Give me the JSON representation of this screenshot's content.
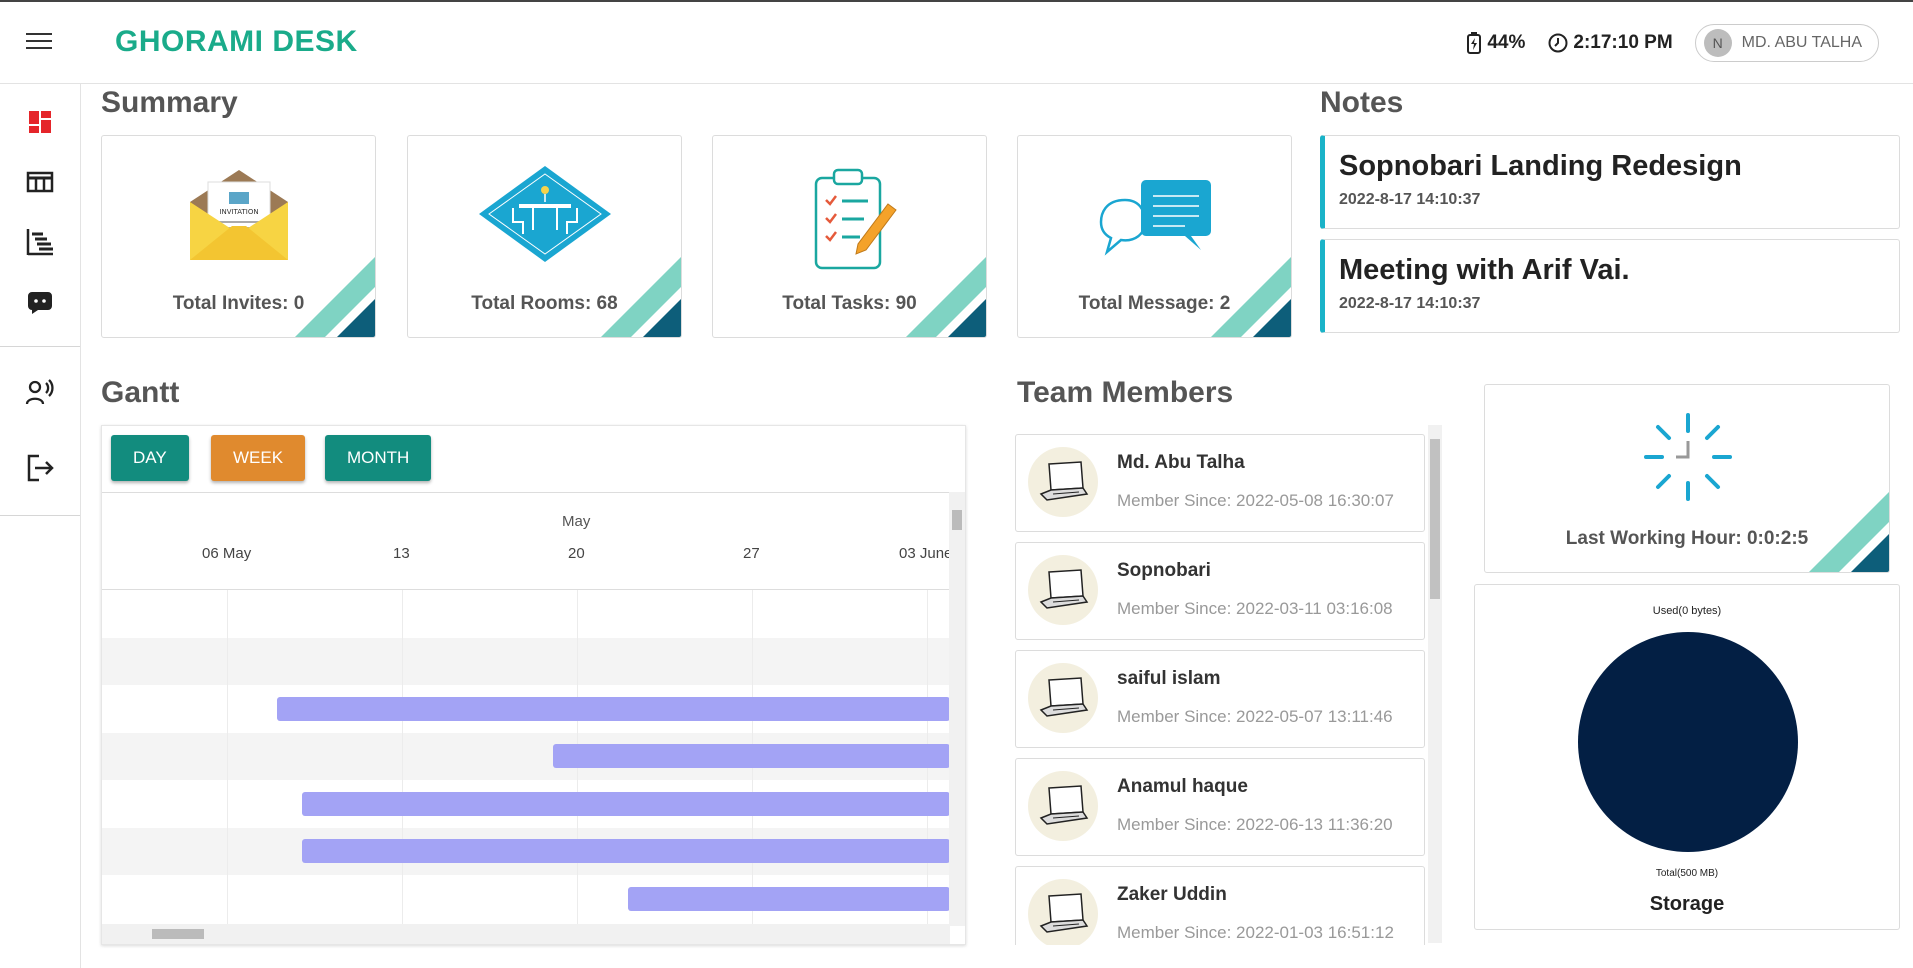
{
  "header": {
    "brand": "GHORAMI DESK",
    "battery": "44%",
    "clock": "2:17:10 PM",
    "user_initial": "N",
    "user_name": "MD. ABU TALHA"
  },
  "summary": {
    "title": "Summary",
    "cards": [
      {
        "caption": "Total Invites: 0",
        "icon": "invitation-envelope-icon"
      },
      {
        "caption": "Total Rooms: 68",
        "icon": "meeting-room-icon"
      },
      {
        "caption": "Total Tasks: 90",
        "icon": "clipboard-tasks-icon"
      },
      {
        "caption": "Total Message: 2",
        "icon": "chat-bubbles-icon"
      }
    ],
    "envelope_card_text": "INVITATION"
  },
  "notes": {
    "title": "Notes",
    "items": [
      {
        "title": "Sopnobari Landing Redesign",
        "date": "2022-8-17 14:10:37"
      },
      {
        "title": "Meeting with Arif Vai.",
        "date": "2022-8-17 14:10:37"
      }
    ]
  },
  "gantt": {
    "title": "Gantt",
    "buttons": {
      "day": "DAY",
      "week": "WEEK",
      "month": "MONTH"
    },
    "month_label": "May",
    "ticks": [
      "06 May",
      "13",
      "20",
      "27",
      "03 June"
    ]
  },
  "team": {
    "title": "Team Members",
    "members": [
      {
        "name": "Md. Abu Talha",
        "since": "Member Since: 2022-05-08 16:30:07"
      },
      {
        "name": "Sopnobari",
        "since": "Member Since: 2022-03-11 03:16:08"
      },
      {
        "name": "saiful islam",
        "since": "Member Since: 2022-05-07 13:11:46"
      },
      {
        "name": "Anamul haque",
        "since": "Member Since: 2022-06-13 11:36:20"
      },
      {
        "name": "Zaker Uddin",
        "since": "Member Since: 2022-01-03 16:51:12"
      }
    ]
  },
  "working": {
    "caption": "Last Working Hour: 0:0:2:5"
  },
  "storage": {
    "used_label": "Used(0 bytes)",
    "total_label": "Total(500 MB)",
    "title": "Storage",
    "used_fraction": 0
  },
  "colors": {
    "brand": "#1aab8a",
    "teal_button": "#128c7e",
    "orange_button": "#e08a2e",
    "gantt_bar": "#a3a3f5",
    "note_accent": "#1ab3c8",
    "pie": "#031f44"
  }
}
